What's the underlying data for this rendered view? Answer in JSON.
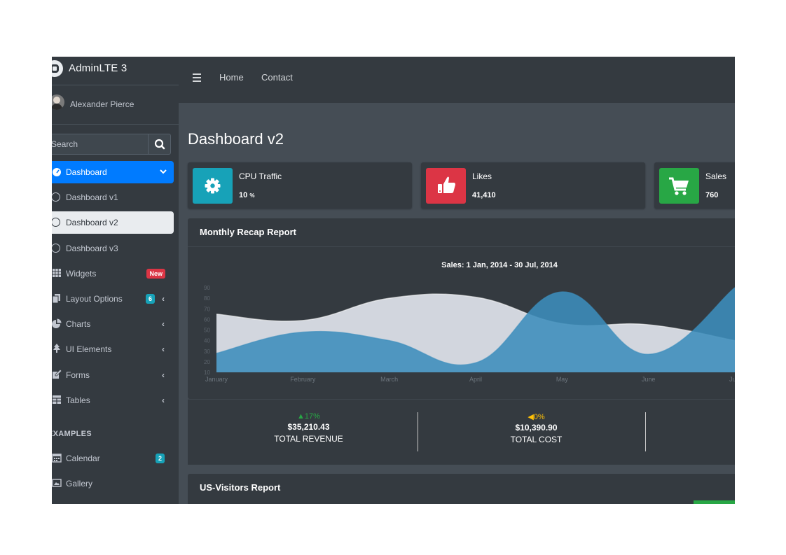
{
  "sidebar": {
    "brand": "AdminLTE 3",
    "user_name": "Alexander Pierce",
    "search_placeholder": "Search",
    "items": [
      {
        "label": "Dashboard"
      },
      {
        "label": "Dashboard v1"
      },
      {
        "label": "Dashboard v2"
      },
      {
        "label": "Dashboard v3"
      },
      {
        "label": "Widgets",
        "badge": "New"
      },
      {
        "label": "Layout Options",
        "badge": "6"
      },
      {
        "label": "Charts"
      },
      {
        "label": "UI Elements"
      },
      {
        "label": "Forms"
      },
      {
        "label": "Tables"
      }
    ],
    "section_header": "EXAMPLES",
    "examples": [
      {
        "label": "Calendar",
        "badge": "2"
      },
      {
        "label": "Gallery"
      }
    ]
  },
  "topnav": {
    "links": [
      "Home",
      "Contact"
    ]
  },
  "page_title": "Dashboard v2",
  "info_boxes": [
    {
      "label": "CPU Traffic",
      "value": "10",
      "unit": "%",
      "color": "#17a2b8",
      "icon": "gear-icon"
    },
    {
      "label": "Likes",
      "value": "41,410",
      "color": "#dc3545",
      "icon": "thumbs-up-icon"
    },
    {
      "label": "Sales",
      "value": "760",
      "color": "#28a745",
      "icon": "shopping-cart-icon"
    }
  ],
  "recap": {
    "title": "Monthly Recap Report",
    "chart_title": "Sales: 1 Jan, 2014 - 30 Jul, 2014"
  },
  "chart_data": {
    "type": "area",
    "title": "Sales: 1 Jan, 2014 - 30 Jul, 2014",
    "categories": [
      "January",
      "February",
      "March",
      "April",
      "May",
      "June",
      "July"
    ],
    "y_ticks": [
      10,
      20,
      30,
      40,
      50,
      60,
      70,
      80,
      90
    ],
    "ylim": [
      10,
      90
    ],
    "series": [
      {
        "values": [
          65,
          59,
          80,
          81,
          56,
          55,
          40
        ],
        "color": "#d2d6de"
      },
      {
        "values": [
          28,
          48,
          40,
          19,
          86,
          27,
          90
        ],
        "color": "#3c8dbc"
      }
    ]
  },
  "summary": [
    {
      "pct": "17%",
      "direction": "up",
      "color": "#28a745",
      "amount": "$35,210.43",
      "label": "TOTAL REVENUE"
    },
    {
      "pct": "0%",
      "direction": "left",
      "color": "#ffc107",
      "amount": "$10,390.90",
      "label": "TOTAL COST"
    }
  ],
  "visitors": {
    "title": "US-Visitors Report"
  }
}
